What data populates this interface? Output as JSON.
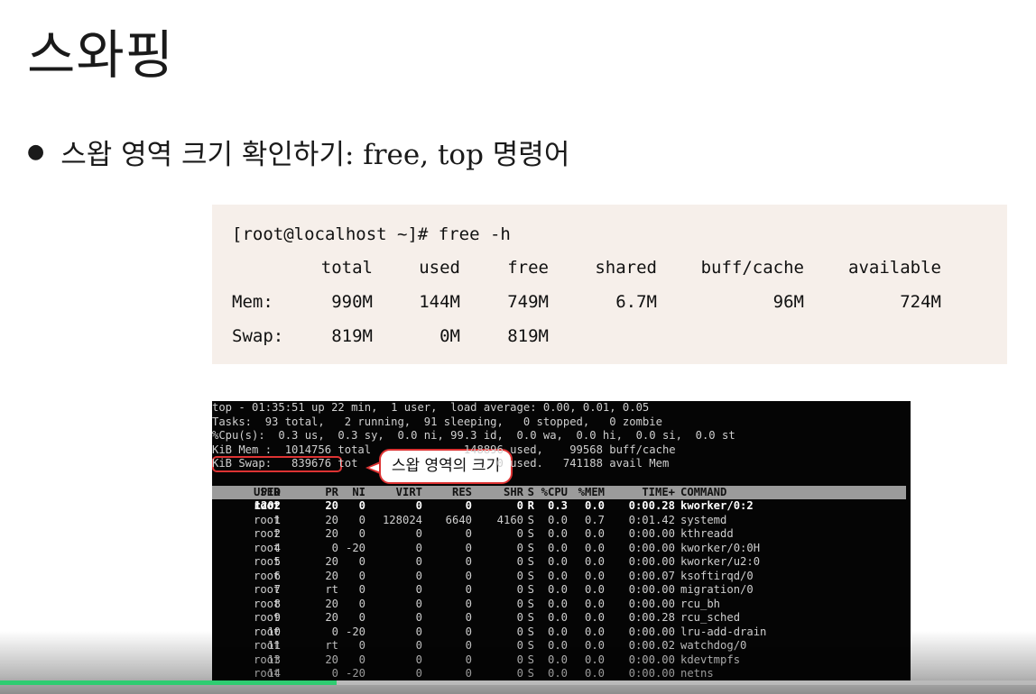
{
  "slide": {
    "title": "스와핑",
    "bullet": "스왑 영역 크기 확인하기: free, top 명령어"
  },
  "free_output": {
    "command": "[root@localhost ~]# free -h",
    "headers": [
      "total",
      "used",
      "free",
      "shared",
      "buff/cache",
      "available"
    ],
    "rows": [
      {
        "label": "Mem:",
        "values": [
          "990M",
          "144M",
          "749M",
          "6.7M",
          "96M",
          "724M"
        ]
      },
      {
        "label": "Swap:",
        "values": [
          "819M",
          "0M",
          "819M",
          "",
          "",
          ""
        ]
      }
    ]
  },
  "top_output": {
    "summary": [
      "top - 01:35:51 up 22 min,  1 user,  load average: 0.00, 0.01, 0.05",
      "Tasks:  93 total,   2 running,  91 sleeping,   0 stopped,   0 zombie",
      "%Cpu(s):  0.3 us,  0.3 sy,  0.0 ni, 99.3 id,  0.0 wa,  0.0 hi,  0.0 si,  0.0 st",
      "KiB Mem :  1014756 total              148896 used,    99568 buff/cache",
      "KiB Swap:   839676 tot                     0 used.   741188 avail Mem"
    ],
    "columns": [
      "PID",
      "USER",
      "PR",
      "NI",
      "VIRT",
      "RES",
      "SHR",
      "S",
      "%CPU",
      "%MEM",
      "TIME+",
      "COMMAND"
    ],
    "processes": [
      [
        "1202",
        "root",
        "20",
        "0",
        "0",
        "0",
        "0",
        "R",
        "0.3",
        "0.0",
        "0:00.28",
        "kworker/0:2"
      ],
      [
        "1",
        "root",
        "20",
        "0",
        "128024",
        "6640",
        "4160",
        "S",
        "0.0",
        "0.7",
        "0:01.42",
        "systemd"
      ],
      [
        "2",
        "root",
        "20",
        "0",
        "0",
        "0",
        "0",
        "S",
        "0.0",
        "0.0",
        "0:00.00",
        "kthreadd"
      ],
      [
        "4",
        "root",
        "0",
        "-20",
        "0",
        "0",
        "0",
        "S",
        "0.0",
        "0.0",
        "0:00.00",
        "kworker/0:0H"
      ],
      [
        "5",
        "root",
        "20",
        "0",
        "0",
        "0",
        "0",
        "S",
        "0.0",
        "0.0",
        "0:00.00",
        "kworker/u2:0"
      ],
      [
        "6",
        "root",
        "20",
        "0",
        "0",
        "0",
        "0",
        "S",
        "0.0",
        "0.0",
        "0:00.07",
        "ksoftirqd/0"
      ],
      [
        "7",
        "root",
        "rt",
        "0",
        "0",
        "0",
        "0",
        "S",
        "0.0",
        "0.0",
        "0:00.00",
        "migration/0"
      ],
      [
        "8",
        "root",
        "20",
        "0",
        "0",
        "0",
        "0",
        "S",
        "0.0",
        "0.0",
        "0:00.00",
        "rcu_bh"
      ],
      [
        "9",
        "root",
        "20",
        "0",
        "0",
        "0",
        "0",
        "S",
        "0.0",
        "0.0",
        "0:00.28",
        "rcu_sched"
      ],
      [
        "10",
        "root",
        "0",
        "-20",
        "0",
        "0",
        "0",
        "S",
        "0.0",
        "0.0",
        "0:00.00",
        "lru-add-drain"
      ],
      [
        "11",
        "root",
        "rt",
        "0",
        "0",
        "0",
        "0",
        "S",
        "0.0",
        "0.0",
        "0:00.02",
        "watchdog/0"
      ],
      [
        "13",
        "root",
        "20",
        "0",
        "0",
        "0",
        "0",
        "S",
        "0.0",
        "0.0",
        "0:00.00",
        "kdevtmpfs"
      ],
      [
        "14",
        "root",
        "0",
        "-20",
        "0",
        "0",
        "0",
        "S",
        "0.0",
        "0.0",
        "0:00.00",
        "netns"
      ]
    ],
    "callout": "스왑 영역의 크기"
  },
  "video": {
    "progress": 0.325,
    "progress_color": "#2ecc71"
  },
  "colors": {
    "accent_red": "#dd3333",
    "terminal_bg": "#050505",
    "free_box_bg": "#f6efea"
  }
}
